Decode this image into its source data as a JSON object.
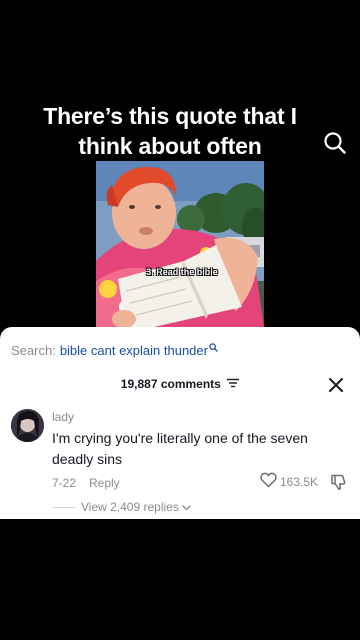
{
  "video": {
    "caption": "There’s this quote that I think about often",
    "overlay_text": "3. Read the bible"
  },
  "comments": {
    "search_label": "Search:",
    "search_query": "bible cant explain thunder",
    "count_label": "19,887 comments",
    "comment": {
      "username": "lady",
      "text": "I'm crying you're literally one of the seven deadly sins",
      "date": "7-22",
      "reply_label": "Reply",
      "likes": "163.5K",
      "view_replies": "View 2,409 replies"
    }
  },
  "icons": {
    "top_search": "search-icon",
    "sort": "sort-icon",
    "close": "close-icon",
    "like": "heart-icon",
    "dislike": "thumbs-down-icon",
    "expand": "chevron-down-icon"
  },
  "colors": {
    "query_link": "#1a4fa0",
    "secondary_text": "#8a8b91",
    "primary_text": "#161823"
  }
}
